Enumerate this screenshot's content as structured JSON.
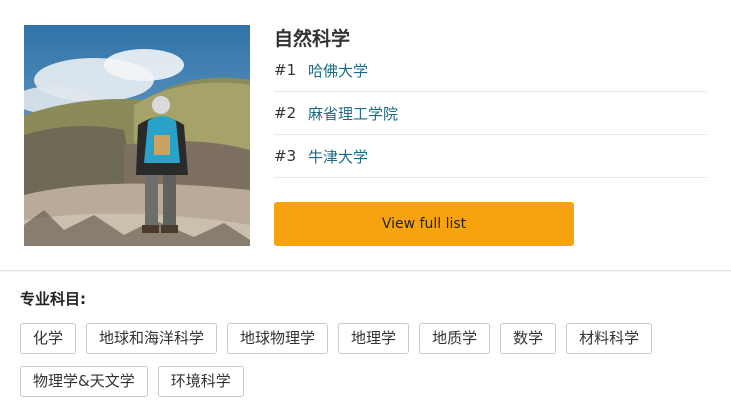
{
  "subject": {
    "title": "自然科学",
    "rankings": [
      {
        "rank": "#1",
        "name": "哈佛大学"
      },
      {
        "rank": "#2",
        "name": "麻省理工学院"
      },
      {
        "rank": "#3",
        "name": "牛津大学"
      }
    ],
    "view_full_list_label": "View full list"
  },
  "specialties": {
    "label": "专业科目:",
    "tags": [
      "化学",
      "地球和海洋科学",
      "地球物理学",
      "地理学",
      "地质学",
      "数学",
      "材料科学",
      "物理学&天文学",
      "环境科学"
    ]
  },
  "colors": {
    "accent_button": "#f6a30f",
    "link": "#1a6c86"
  }
}
